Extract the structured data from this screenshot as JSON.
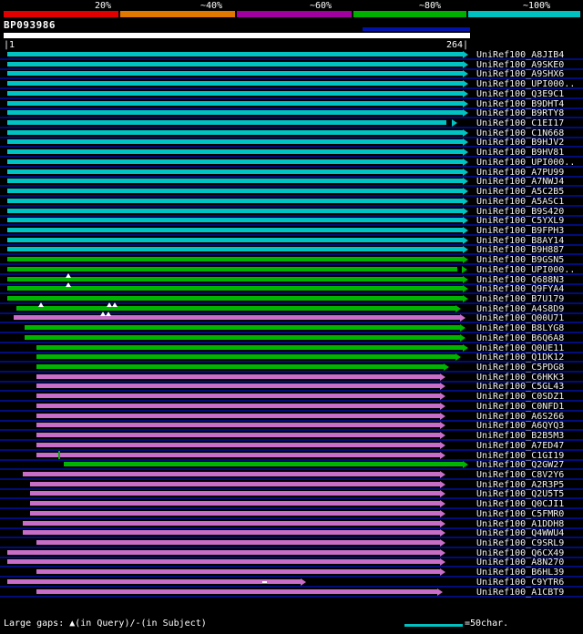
{
  "legend": {
    "items": [
      {
        "label": "20%",
        "color": "#e00000"
      },
      {
        "label": "~40%",
        "color": "#e07800"
      },
      {
        "label": "~60%",
        "color": "#a000a0"
      },
      {
        "label": "~80%",
        "color": "#00b000"
      },
      {
        "label": "~100%",
        "color": "#00c0c0"
      }
    ]
  },
  "query": {
    "accession": "BP093986",
    "start_label": "|1",
    "end_label": "264|",
    "length": 264
  },
  "footer": {
    "gaps_note": "Large gaps: ▲(in Query)/-(in Subject)",
    "scale_note": "=50char.",
    "scale_line_color": "#00c0c0"
  },
  "colors": {
    "cyan": "#00c4c4",
    "green": "#00b400",
    "magenta": "#c86ec8",
    "navy": "#000d7a",
    "white": "#ffffff"
  },
  "chart_data": {
    "type": "bar",
    "orientation": "horizontal",
    "title": "BP093986",
    "x_range": [
      1,
      264
    ],
    "identity_legend": [
      "20%",
      "~40%",
      "~60%",
      "~80%",
      "~100%"
    ],
    "rows": [
      {
        "label": "UniRef100_A8JIB4",
        "color": "cyan",
        "x1": 8,
        "x2": 508
      },
      {
        "label": "UniRef100_A9SKE0",
        "color": "cyan",
        "x1": 8,
        "x2": 508
      },
      {
        "label": "UniRef100_A9SHX6",
        "color": "cyan",
        "x1": 8,
        "x2": 508
      },
      {
        "label": "UniRef100_UPI000..",
        "color": "cyan",
        "x1": 8,
        "x2": 508
      },
      {
        "label": "UniRef100_Q3E9C1",
        "color": "cyan",
        "x1": 8,
        "x2": 508
      },
      {
        "label": "UniRef100_B9DHT4",
        "color": "cyan",
        "x1": 8,
        "x2": 508
      },
      {
        "label": "UniRef100_B9RTY8",
        "color": "cyan",
        "x1": 8,
        "x2": 508
      },
      {
        "label": "UniRef100_C1EI17",
        "color": "cyan",
        "x1": 8,
        "x2": 490,
        "arrow_x": 496
      },
      {
        "label": "UniRef100_C1N668",
        "color": "cyan",
        "x1": 8,
        "x2": 508
      },
      {
        "label": "UniRef100_B9HJV2",
        "color": "cyan",
        "x1": 8,
        "x2": 508
      },
      {
        "label": "UniRef100_B9HV81",
        "color": "cyan",
        "x1": 8,
        "x2": 508
      },
      {
        "label": "UniRef100_UPI000..",
        "color": "cyan",
        "x1": 8,
        "x2": 508
      },
      {
        "label": "UniRef100_A7PU99",
        "color": "cyan",
        "x1": 8,
        "x2": 508
      },
      {
        "label": "UniRef100_A7NWJ4",
        "color": "cyan",
        "x1": 8,
        "x2": 508
      },
      {
        "label": "UniRef100_A5C2B5",
        "color": "cyan",
        "x1": 8,
        "x2": 508
      },
      {
        "label": "UniRef100_A5ASC1",
        "color": "cyan",
        "x1": 8,
        "x2": 508
      },
      {
        "label": "UniRef100_B9S420",
        "color": "cyan",
        "x1": 8,
        "x2": 508
      },
      {
        "label": "UniRef100_C5YXL9",
        "color": "cyan",
        "x1": 8,
        "x2": 508
      },
      {
        "label": "UniRef100_B9FPH3",
        "color": "cyan",
        "x1": 8,
        "x2": 508
      },
      {
        "label": "UniRef100_B8AY14",
        "color": "cyan",
        "x1": 8,
        "x2": 508
      },
      {
        "label": "UniRef100_B9H887",
        "color": "cyan",
        "x1": 8,
        "x2": 508
      },
      {
        "label": "UniRef100_B9GSN5",
        "color": "green",
        "x1": 8,
        "x2": 508
      },
      {
        "label": "UniRef100_UPI000..",
        "color": "green",
        "x1": 8,
        "x2": 502,
        "arrow_x": 507
      },
      {
        "label": "UniRef100_Q688N3",
        "color": "green",
        "x1": 8,
        "x2": 508,
        "gaps": [
          75
        ]
      },
      {
        "label": "UniRef100_Q9FYA4",
        "color": "green",
        "x1": 8,
        "x2": 508,
        "gaps": [
          75
        ]
      },
      {
        "label": "UniRef100_B7U179",
        "color": "green",
        "x1": 8,
        "x2": 508
      },
      {
        "label": "UniRef100_A4S8D9",
        "color": "green",
        "x1": 18,
        "x2": 500,
        "gaps": [
          45,
          120,
          126
        ]
      },
      {
        "label": "UniRef100_Q00U71",
        "color": "magenta",
        "x1": 15,
        "x2": 505,
        "gaps": [
          113,
          119
        ]
      },
      {
        "label": "UniRef100_B8LYG8",
        "color": "green",
        "x1": 27,
        "x2": 505
      },
      {
        "label": "UniRef100_B6Q6A8",
        "color": "green",
        "x1": 27,
        "x2": 505
      },
      {
        "label": "UniRef100_Q0UE11",
        "color": "green",
        "x1": 40,
        "x2": 508
      },
      {
        "label": "UniRef100_Q1DK12",
        "color": "green",
        "x1": 40,
        "x2": 500
      },
      {
        "label": "UniRef100_C5PDG8",
        "color": "green",
        "x1": 40,
        "x2": 487
      },
      {
        "label": "UniRef100_C6HKK3",
        "color": "magenta",
        "x1": 40,
        "x2": 483
      },
      {
        "label": "UniRef100_C5GL43",
        "color": "magenta",
        "x1": 40,
        "x2": 483
      },
      {
        "label": "UniRef100_C0SDZ1",
        "color": "magenta",
        "x1": 40,
        "x2": 483
      },
      {
        "label": "UniRef100_C0NFD1",
        "color": "magenta",
        "x1": 40,
        "x2": 483
      },
      {
        "label": "UniRef100_A6S266",
        "color": "magenta",
        "x1": 40,
        "x2": 483
      },
      {
        "label": "UniRef100_A6QYQ3",
        "color": "magenta",
        "x1": 40,
        "x2": 483
      },
      {
        "label": "UniRef100_B2B5M3",
        "color": "magenta",
        "x1": 40,
        "x2": 483
      },
      {
        "label": "UniRef100_A7ED47",
        "color": "magenta",
        "x1": 40,
        "x2": 483
      },
      {
        "label": "UniRef100_C1GI19",
        "color": "magenta",
        "x1": 40,
        "x2": 483,
        "ticks": [
          {
            "x": 64,
            "color": "green"
          }
        ]
      },
      {
        "label": "UniRef100_Q2GW27",
        "color": "green",
        "x1": 70,
        "x2": 508
      },
      {
        "label": "UniRef100_C8V2Y6",
        "color": "magenta",
        "x1": 25,
        "x2": 483
      },
      {
        "label": "UniRef100_A2R3P5",
        "color": "magenta",
        "x1": 33,
        "x2": 483
      },
      {
        "label": "UniRef100_Q2U5T5",
        "color": "magenta",
        "x1": 33,
        "x2": 483
      },
      {
        "label": "UniRef100_Q0CJI1",
        "color": "magenta",
        "x1": 33,
        "x2": 483
      },
      {
        "label": "UniRef100_C5FMR0",
        "color": "magenta",
        "x1": 33,
        "x2": 483
      },
      {
        "label": "UniRef100_A1DDH8",
        "color": "magenta",
        "x1": 25,
        "x2": 483
      },
      {
        "label": "UniRef100_Q4WWU4",
        "color": "magenta",
        "x1": 25,
        "x2": 483
      },
      {
        "label": "UniRef100_C9SRL9",
        "color": "magenta",
        "x1": 40,
        "x2": 483
      },
      {
        "label": "UniRef100_Q6CX49",
        "color": "magenta",
        "x1": 8,
        "x2": 483
      },
      {
        "label": "UniRef100_A8N270",
        "color": "magenta",
        "x1": 8,
        "x2": 483
      },
      {
        "label": "UniRef100_B6HL39",
        "color": "magenta",
        "x1": 40,
        "x2": 483
      },
      {
        "label": "UniRef100_C9YTR6",
        "color": "magenta",
        "x1": 8,
        "x2": 330,
        "dashes": [
          288
        ]
      },
      {
        "label": "UniRef100_A1CBT9",
        "color": "magenta",
        "x1": 40,
        "x2": 480
      }
    ]
  }
}
